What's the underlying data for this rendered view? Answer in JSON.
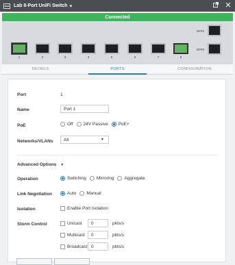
{
  "window": {
    "title": "Lab 8-Port UniFi Switch",
    "chevron": "▾",
    "icons": [
      "switch-logo-icon",
      "open-external-icon",
      "close-icon"
    ]
  },
  "status": {
    "text": "Connected",
    "color": "#3cb65a"
  },
  "device": {
    "ports": [
      {
        "label": "1",
        "state": "active"
      },
      {
        "label": "2",
        "state": "idle"
      },
      {
        "label": "3",
        "state": "idle"
      },
      {
        "label": "4",
        "state": "idle"
      },
      {
        "label": "5",
        "state": "idle"
      },
      {
        "label": "6",
        "state": "idle"
      },
      {
        "label": "7",
        "state": "idle"
      },
      {
        "label": "8",
        "state": "active"
      }
    ],
    "sfp": [
      {
        "label": "SFP1"
      },
      {
        "label": "SFP2"
      }
    ]
  },
  "tabs": [
    {
      "label": "DETAILS",
      "active": false
    },
    {
      "label": "PORTS",
      "active": true
    },
    {
      "label": "CONFIGURATION",
      "active": false
    }
  ],
  "form": {
    "port_label": "Port",
    "port_value": "1",
    "name_label": "Name",
    "name_value": "Port 1",
    "poe_label": "PoE",
    "poe_options": [
      "Off",
      "24V Passive",
      "PoE+"
    ],
    "poe_selected": "PoE+",
    "vlan_label": "Networks/VLANs",
    "vlan_value": "All",
    "advanced_label": "Advanced Options",
    "operation_label": "Operation",
    "operation_options": [
      "Switching",
      "Mirroring",
      "Aggregate"
    ],
    "operation_selected": "Switching",
    "link_label": "Link Negotiation",
    "link_options": [
      "Auto",
      "Manual"
    ],
    "link_selected": "Auto",
    "isolation_label": "Isolation",
    "isolation_option": "Enable Port Isolation",
    "storm_label": "Storm Control",
    "storm_rows": [
      {
        "label": "Unicast",
        "value": "0",
        "unit": "pkts/s"
      },
      {
        "label": "Multicast",
        "value": "0",
        "unit": "pkts/s"
      },
      {
        "label": "Broadcast",
        "value": "0",
        "unit": "pkts/s"
      }
    ]
  },
  "colors": {
    "accent": "#2a7ab8",
    "titlebar": "#4a4d52",
    "active_port": "#64b164"
  }
}
